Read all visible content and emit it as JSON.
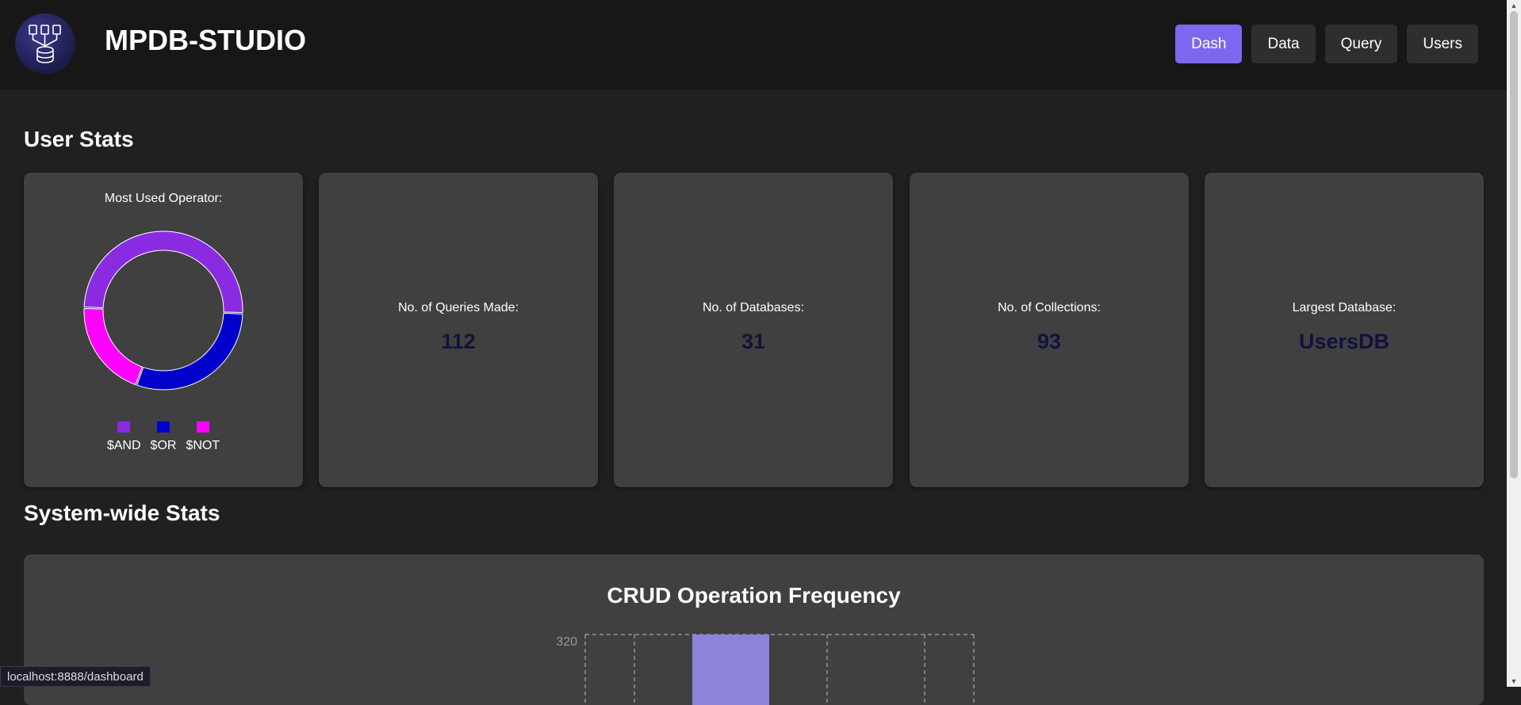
{
  "header": {
    "title": "MPDB-STUDIO",
    "nav": [
      {
        "label": "Dash",
        "active": true
      },
      {
        "label": "Data",
        "active": false
      },
      {
        "label": "Query",
        "active": false
      },
      {
        "label": "Users",
        "active": false
      }
    ]
  },
  "sections": {
    "user_stats": "User Stats",
    "system_stats": "System-wide Stats"
  },
  "cards": {
    "operator": {
      "title": "Most Used Operator:",
      "legend": [
        {
          "label": "$AND",
          "color": "#8a2be2"
        },
        {
          "label": "$OR",
          "color": "#0000cd"
        },
        {
          "label": "$NOT",
          "color": "#ff00ff"
        }
      ]
    },
    "queries": {
      "label": "No. of Queries Made:",
      "value": "112"
    },
    "databases": {
      "label": "No. of Databases:",
      "value": "31"
    },
    "collections": {
      "label": "No. of Collections:",
      "value": "93"
    },
    "largest": {
      "label": "Largest Database:",
      "value": "UsersDB"
    }
  },
  "chart_data": [
    {
      "type": "pie",
      "title": "Most Used Operator:",
      "categories": [
        "$AND",
        "$OR",
        "$NOT"
      ],
      "values": [
        50,
        30,
        20
      ],
      "colors": [
        "#8a2be2",
        "#0000cd",
        "#ff00ff"
      ]
    },
    {
      "type": "bar",
      "title": "CRUD Operation Frequency",
      "ytick_visible": [
        "320"
      ],
      "bar_color": "#8b84d7",
      "grid": "dashed"
    }
  ],
  "crud_chart": {
    "title": "CRUD Operation Frequency",
    "ytick_top": "320"
  },
  "status_url": "localhost:8888/dashboard"
}
